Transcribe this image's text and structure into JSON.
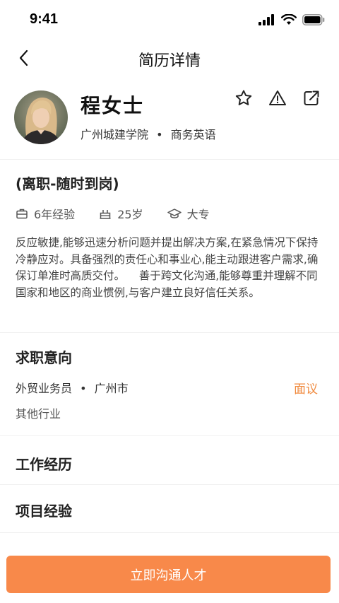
{
  "status_bar": {
    "time": "9:41"
  },
  "nav": {
    "title": "简历详情"
  },
  "profile": {
    "name": "程女士",
    "school": "广州城建学院",
    "separator": "•",
    "major": "商务英语"
  },
  "job_status": "(离职-随时到岗)",
  "meta": {
    "experience": "6年经验",
    "age": "25岁",
    "education": "大专"
  },
  "summary": "反应敏捷,能够迅速分析问题并提出解决方案,在紧急情况下保持冷静应对。具备强烈的责任心和事业心,能主动跟进客户需求,确保订单准时高质交付。    善于跨文化沟通,能够尊重并理解不同国家和地区的商业惯例,与客户建立良好信任关系。",
  "intent": {
    "title": "求职意向",
    "position": "外贸业务员",
    "separator": "•",
    "city": "广州市",
    "salary": "面议",
    "industry": "其他行业"
  },
  "sections": {
    "work_experience": "工作经历",
    "project_experience": "项目经验"
  },
  "cta": {
    "label": "立即沟通人才"
  },
  "colors": {
    "accent": "#f8894a",
    "salary": "#f08a3e"
  }
}
